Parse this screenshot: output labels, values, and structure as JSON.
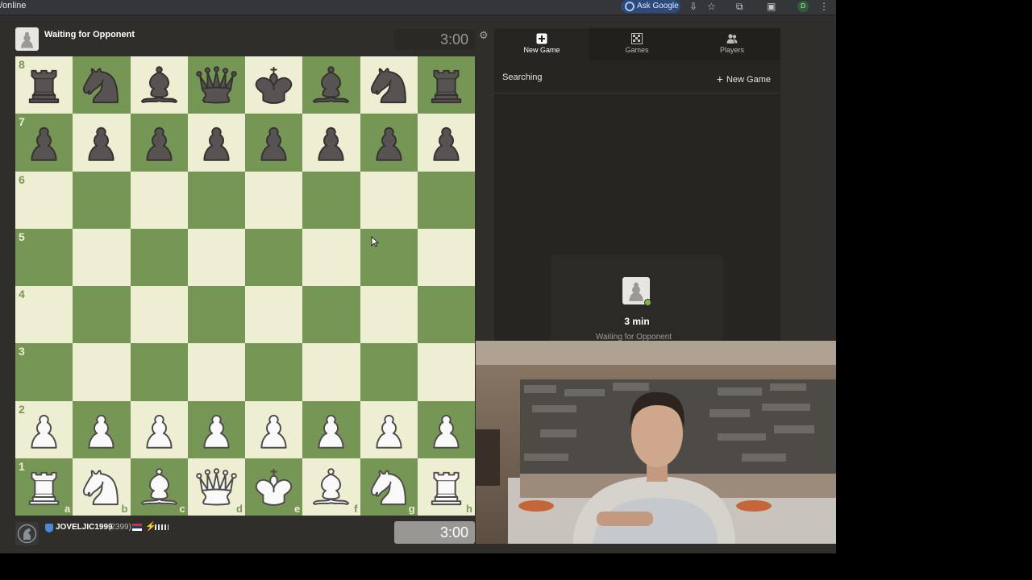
{
  "browser": {
    "url": "/online",
    "ask_google": "Ask Google",
    "profile_initial": "D"
  },
  "top_player": {
    "name": "Waiting for Opponent",
    "clock": "3:00"
  },
  "board": {
    "light_color": "#eeeed2",
    "dark_color": "#769656",
    "ranks": [
      "8",
      "7",
      "6",
      "5",
      "4",
      "3",
      "2",
      "1"
    ],
    "files": [
      "a",
      "b",
      "c",
      "d",
      "e",
      "f",
      "g",
      "h"
    ],
    "position": [
      [
        "r",
        "n",
        "b",
        "q",
        "k",
        "b",
        "n",
        "r"
      ],
      [
        "p",
        "p",
        "p",
        "p",
        "p",
        "p",
        "p",
        "p"
      ],
      [
        "",
        "",
        "",
        "",
        "",
        "",
        "",
        ""
      ],
      [
        "",
        "",
        "",
        "",
        "",
        "",
        "",
        ""
      ],
      [
        "",
        "",
        "",
        "",
        "",
        "",
        "",
        ""
      ],
      [
        "",
        "",
        "",
        "",
        "",
        "",
        "",
        ""
      ],
      [
        "P",
        "P",
        "P",
        "P",
        "P",
        "P",
        "P",
        "P"
      ],
      [
        "R",
        "N",
        "B",
        "Q",
        "K",
        "B",
        "N",
        "R"
      ]
    ]
  },
  "bottom_player": {
    "name": "JOVELJIC1999",
    "rating": "(2399)",
    "clock": "3:00"
  },
  "panel": {
    "tabs": [
      {
        "label": "New Game",
        "icon": "plus-square-icon"
      },
      {
        "label": "Games",
        "icon": "board-icon"
      },
      {
        "label": "Players",
        "icon": "players-icon"
      }
    ],
    "searching": "Searching",
    "new_game": "New Game",
    "seek": {
      "time": "3 min",
      "status": "Waiting for Opponent"
    }
  }
}
